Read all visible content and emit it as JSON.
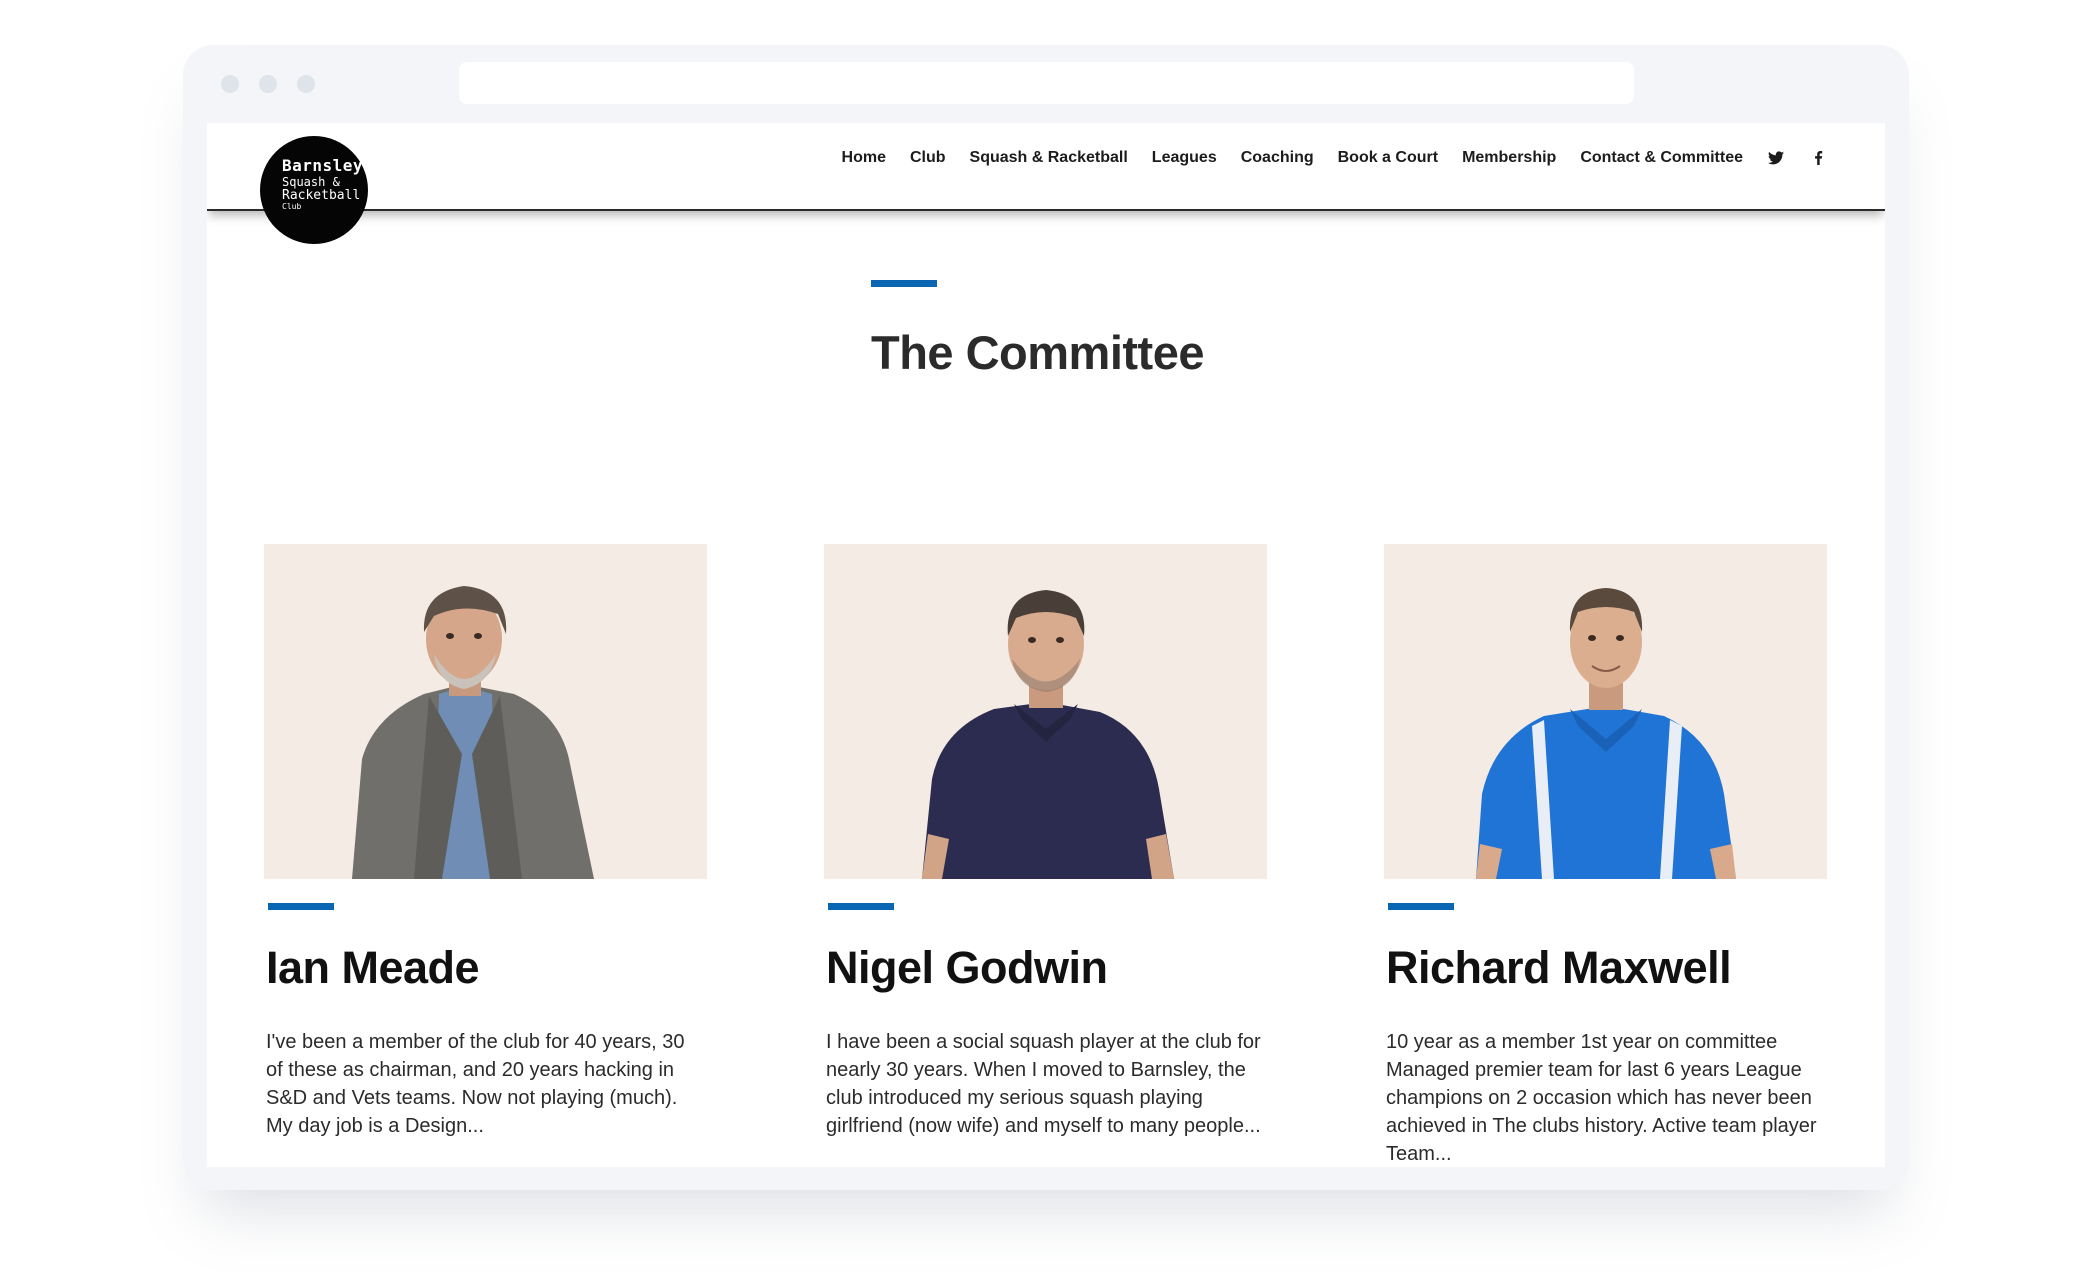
{
  "site": {
    "logo": {
      "line1": "Barnsley",
      "line2": "Squash &",
      "line3": "Racketball",
      "line4": "Club"
    },
    "nav": [
      {
        "label": "Home"
      },
      {
        "label": "Club"
      },
      {
        "label": "Squash & Racketball"
      },
      {
        "label": "Leagues"
      },
      {
        "label": "Coaching"
      },
      {
        "label": "Book a Court"
      },
      {
        "label": "Membership"
      },
      {
        "label": "Contact & Committee"
      }
    ],
    "social": [
      "twitter-icon",
      "facebook-icon"
    ]
  },
  "section": {
    "title": "The Committee"
  },
  "members": [
    {
      "name": "Ian Meade",
      "bio": "I've been a member of the club for 40 years, 30 of these as chairman, and 20 years hacking in S&D and Vets teams. Now not playing (much). My day job is a Design..."
    },
    {
      "name": "Nigel Godwin",
      "bio": "I have been a social squash player at the club for nearly 30 years. When I moved to Barnsley, the club introduced my serious squash playing girlfriend (now wife) and myself to many people..."
    },
    {
      "name": "Richard Maxwell",
      "bio": "10 year as a member 1st year on committee Managed premier team for last 6 years League champions on 2 occasion which has never been achieved in The clubs history. Active team player Team..."
    }
  ],
  "colors": {
    "accent": "#0a66b3",
    "photo_bg": "#f4ebe4",
    "text": "#2b2b2b"
  }
}
